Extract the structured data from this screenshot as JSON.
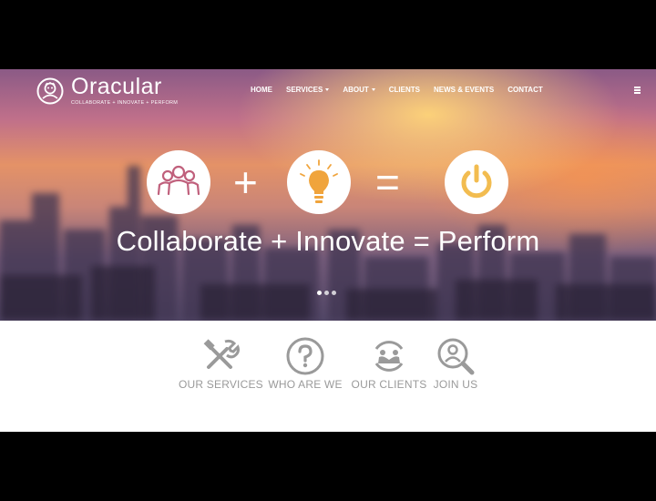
{
  "brand": {
    "name": "Oracular",
    "tagline": "COLLABORATE + INNOVATE + PERFORM"
  },
  "nav": {
    "items": [
      {
        "label": "HOME",
        "dropdown": false
      },
      {
        "label": "SERVICES",
        "dropdown": true
      },
      {
        "label": "ABOUT",
        "dropdown": true
      },
      {
        "label": "CLIENTS",
        "dropdown": false
      },
      {
        "label": "NEWS & EVENTS",
        "dropdown": false
      },
      {
        "label": "CONTACT",
        "dropdown": false
      }
    ],
    "menu_icon": "hamburger-icon"
  },
  "hero": {
    "icons": [
      "people-icon",
      "lightbulb-icon",
      "power-icon"
    ],
    "operators": [
      "+",
      "="
    ],
    "title": "Collaborate + Innovate = Perform",
    "slides": 3,
    "active_slide": 1
  },
  "features": [
    {
      "label": "OUR SERVICES",
      "icon": "tools-icon"
    },
    {
      "label": "WHO ARE WE",
      "icon": "question-icon"
    },
    {
      "label": "OUR CLIENTS",
      "icon": "handshake-icon"
    },
    {
      "label": "JOIN US",
      "icon": "person-search-icon"
    }
  ],
  "colors": {
    "people_icon": "#c0607c",
    "lightbulb_icon": "#f0a43c",
    "power_icon": "#f2bc50",
    "feature_gray": "#9a9a9a"
  }
}
